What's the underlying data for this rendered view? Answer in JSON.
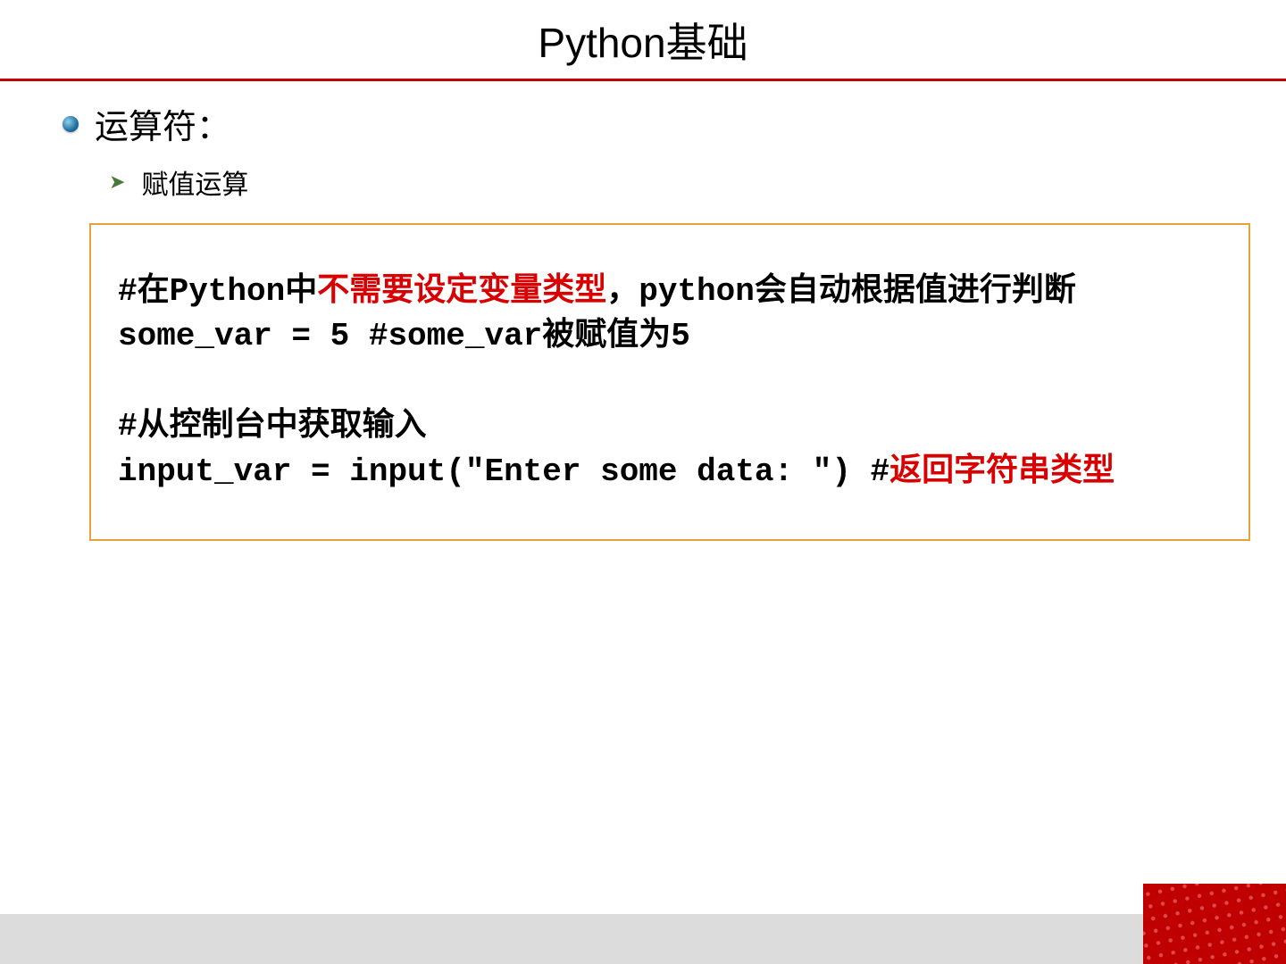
{
  "title": "Python基础",
  "bullet": "运算符：",
  "subBullet": "赋值运算",
  "code": {
    "l1a": "#在Python中",
    "l1b": "不需要设定变量类型",
    "l1c": "，python会自动根据值进行判断",
    "l2": "some_var = 5  #some_var被赋值为5",
    "blank": " ",
    "l3": "#从控制台中获取输入",
    "l4a": "input_var = input(\"Enter some data: \") #",
    "l4b": "返回字符串类型"
  }
}
